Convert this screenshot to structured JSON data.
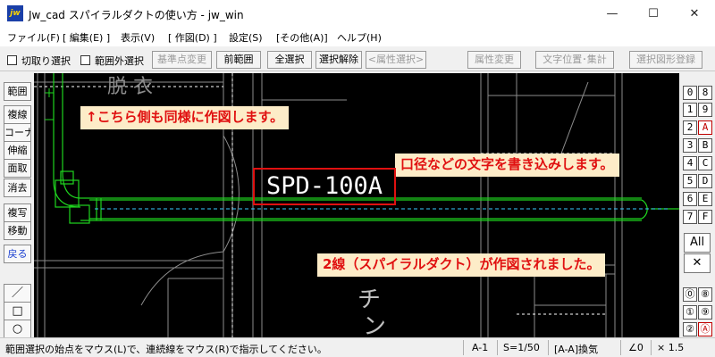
{
  "window": {
    "title": "Jw_cad スパイラルダクトの使い方 - jw_win",
    "app_icon_text": "jw",
    "minimize": "—",
    "maximize": "☐",
    "close": "✕"
  },
  "menu": [
    "ファイル(F)",
    "[ 編集(E) ]",
    "表示(V)",
    "[ 作図(D) ]",
    "設定(S)",
    "[その他(A)]",
    "ヘルプ(H)"
  ],
  "toolbar": {
    "checkbox1_label": "切取り選択",
    "checkbox2_label": "範囲外選択",
    "base_point_change": "基準点変更",
    "prev_range": "前範囲",
    "select_all": "全選択",
    "deselect": "選択解除",
    "attr_select": "<属性選択>",
    "attr_change": "属性変更",
    "text_pos_total": "文字位置･集計",
    "register_shape": "選択図形登録"
  },
  "left_tools": [
    "範囲",
    "複線",
    "コーナー",
    "伸縮",
    "面取",
    "消去",
    "複写",
    "移動",
    "戻る"
  ],
  "left_shapes": {
    "line": "／",
    "rect": "□",
    "circle": "○"
  },
  "right_panel": {
    "rows": [
      [
        "0",
        "8"
      ],
      [
        "1",
        "9"
      ],
      [
        "2",
        "A"
      ],
      [
        "3",
        "B"
      ],
      [
        "4",
        "C"
      ],
      [
        "5",
        "D"
      ],
      [
        "6",
        "E"
      ],
      [
        "7",
        "F"
      ]
    ],
    "all": "All",
    "cross": "✕",
    "circle_rows": [
      [
        "⓪",
        "⑧"
      ],
      [
        "①",
        "⑨"
      ],
      [
        "②",
        "Ⓐ"
      ]
    ]
  },
  "canvas": {
    "background_text": "脱 衣",
    "vertical_text_1": "チ",
    "vertical_text_2": "ン",
    "duct_label": "SPD-100A"
  },
  "annotations": {
    "note1": "↑こちら側も同様に作図します。",
    "note2": "口径などの文字を書き込みします。",
    "note3": "2線（スパイラルダクト）が作図されました。"
  },
  "status": {
    "message": "範囲選択の始点をマウス(L)で、連続線をマウス(R)で指示してください。",
    "layer": "A-1",
    "scale": "S=1/50",
    "layer_name": "[A-A]換気",
    "angle": "∠0",
    "factor": "× 1.5"
  },
  "colors": {
    "canvas_bg": "#000000",
    "cad_green": "#1fd41f",
    "cad_white": "#ffffff",
    "cad_gray": "#8c8c8c",
    "annotation_red": "#e01010",
    "annotation_bg": "#fdecc8"
  }
}
